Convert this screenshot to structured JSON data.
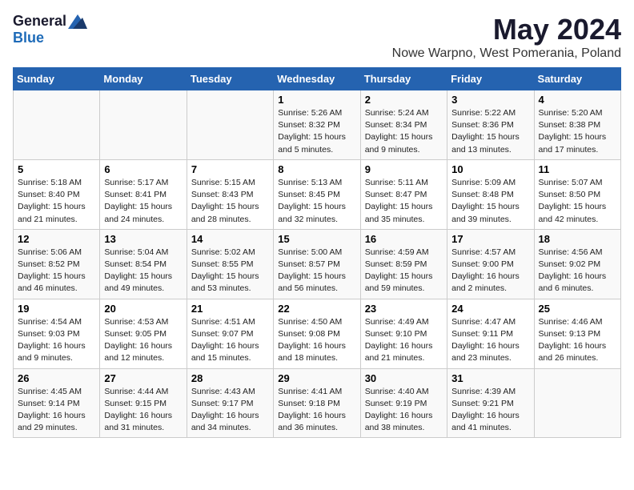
{
  "logo": {
    "general": "General",
    "blue": "Blue"
  },
  "title": "May 2024",
  "subtitle": "Nowe Warpno, West Pomerania, Poland",
  "days_header": [
    "Sunday",
    "Monday",
    "Tuesday",
    "Wednesday",
    "Thursday",
    "Friday",
    "Saturday"
  ],
  "weeks": [
    [
      {
        "day": "",
        "info": ""
      },
      {
        "day": "",
        "info": ""
      },
      {
        "day": "",
        "info": ""
      },
      {
        "day": "1",
        "info": "Sunrise: 5:26 AM\nSunset: 8:32 PM\nDaylight: 15 hours\nand 5 minutes."
      },
      {
        "day": "2",
        "info": "Sunrise: 5:24 AM\nSunset: 8:34 PM\nDaylight: 15 hours\nand 9 minutes."
      },
      {
        "day": "3",
        "info": "Sunrise: 5:22 AM\nSunset: 8:36 PM\nDaylight: 15 hours\nand 13 minutes."
      },
      {
        "day": "4",
        "info": "Sunrise: 5:20 AM\nSunset: 8:38 PM\nDaylight: 15 hours\nand 17 minutes."
      }
    ],
    [
      {
        "day": "5",
        "info": "Sunrise: 5:18 AM\nSunset: 8:40 PM\nDaylight: 15 hours\nand 21 minutes."
      },
      {
        "day": "6",
        "info": "Sunrise: 5:17 AM\nSunset: 8:41 PM\nDaylight: 15 hours\nand 24 minutes."
      },
      {
        "day": "7",
        "info": "Sunrise: 5:15 AM\nSunset: 8:43 PM\nDaylight: 15 hours\nand 28 minutes."
      },
      {
        "day": "8",
        "info": "Sunrise: 5:13 AM\nSunset: 8:45 PM\nDaylight: 15 hours\nand 32 minutes."
      },
      {
        "day": "9",
        "info": "Sunrise: 5:11 AM\nSunset: 8:47 PM\nDaylight: 15 hours\nand 35 minutes."
      },
      {
        "day": "10",
        "info": "Sunrise: 5:09 AM\nSunset: 8:48 PM\nDaylight: 15 hours\nand 39 minutes."
      },
      {
        "day": "11",
        "info": "Sunrise: 5:07 AM\nSunset: 8:50 PM\nDaylight: 15 hours\nand 42 minutes."
      }
    ],
    [
      {
        "day": "12",
        "info": "Sunrise: 5:06 AM\nSunset: 8:52 PM\nDaylight: 15 hours\nand 46 minutes."
      },
      {
        "day": "13",
        "info": "Sunrise: 5:04 AM\nSunset: 8:54 PM\nDaylight: 15 hours\nand 49 minutes."
      },
      {
        "day": "14",
        "info": "Sunrise: 5:02 AM\nSunset: 8:55 PM\nDaylight: 15 hours\nand 53 minutes."
      },
      {
        "day": "15",
        "info": "Sunrise: 5:00 AM\nSunset: 8:57 PM\nDaylight: 15 hours\nand 56 minutes."
      },
      {
        "day": "16",
        "info": "Sunrise: 4:59 AM\nSunset: 8:59 PM\nDaylight: 15 hours\nand 59 minutes."
      },
      {
        "day": "17",
        "info": "Sunrise: 4:57 AM\nSunset: 9:00 PM\nDaylight: 16 hours\nand 2 minutes."
      },
      {
        "day": "18",
        "info": "Sunrise: 4:56 AM\nSunset: 9:02 PM\nDaylight: 16 hours\nand 6 minutes."
      }
    ],
    [
      {
        "day": "19",
        "info": "Sunrise: 4:54 AM\nSunset: 9:03 PM\nDaylight: 16 hours\nand 9 minutes."
      },
      {
        "day": "20",
        "info": "Sunrise: 4:53 AM\nSunset: 9:05 PM\nDaylight: 16 hours\nand 12 minutes."
      },
      {
        "day": "21",
        "info": "Sunrise: 4:51 AM\nSunset: 9:07 PM\nDaylight: 16 hours\nand 15 minutes."
      },
      {
        "day": "22",
        "info": "Sunrise: 4:50 AM\nSunset: 9:08 PM\nDaylight: 16 hours\nand 18 minutes."
      },
      {
        "day": "23",
        "info": "Sunrise: 4:49 AM\nSunset: 9:10 PM\nDaylight: 16 hours\nand 21 minutes."
      },
      {
        "day": "24",
        "info": "Sunrise: 4:47 AM\nSunset: 9:11 PM\nDaylight: 16 hours\nand 23 minutes."
      },
      {
        "day": "25",
        "info": "Sunrise: 4:46 AM\nSunset: 9:13 PM\nDaylight: 16 hours\nand 26 minutes."
      }
    ],
    [
      {
        "day": "26",
        "info": "Sunrise: 4:45 AM\nSunset: 9:14 PM\nDaylight: 16 hours\nand 29 minutes."
      },
      {
        "day": "27",
        "info": "Sunrise: 4:44 AM\nSunset: 9:15 PM\nDaylight: 16 hours\nand 31 minutes."
      },
      {
        "day": "28",
        "info": "Sunrise: 4:43 AM\nSunset: 9:17 PM\nDaylight: 16 hours\nand 34 minutes."
      },
      {
        "day": "29",
        "info": "Sunrise: 4:41 AM\nSunset: 9:18 PM\nDaylight: 16 hours\nand 36 minutes."
      },
      {
        "day": "30",
        "info": "Sunrise: 4:40 AM\nSunset: 9:19 PM\nDaylight: 16 hours\nand 38 minutes."
      },
      {
        "day": "31",
        "info": "Sunrise: 4:39 AM\nSunset: 9:21 PM\nDaylight: 16 hours\nand 41 minutes."
      },
      {
        "day": "",
        "info": ""
      }
    ]
  ]
}
